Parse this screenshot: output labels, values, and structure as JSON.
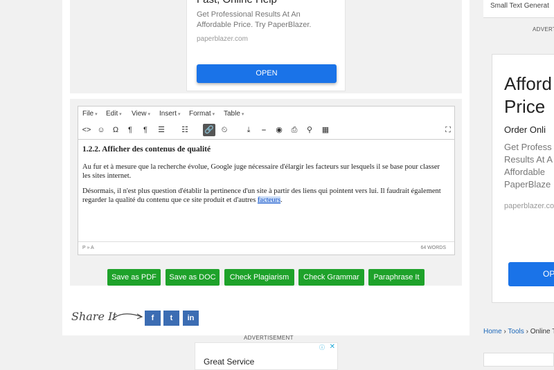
{
  "top_ad": {
    "headline": "Fast, Online Help",
    "description": "Get Professional Results At An Affordable Price. Try PaperBlazer.",
    "url": "paperblazer.com",
    "button": "OPEN"
  },
  "editor": {
    "menus": [
      "File",
      "Edit",
      "View",
      "Insert",
      "Format",
      "Table"
    ],
    "content": {
      "heading": "1.2.2. Afficher des contenus de qualité",
      "paragraph1": "Au fur et à mesure que la recherche évolue, Google juge nécessaire d'élargir les facteurs sur lesquels il se base pour classer les sites internet.",
      "paragraph2_before": "Désormais, il n'est plus question d'établir la pertinence d'un site à partir des liens qui pointent vers lui. Il faudrait également regarder la qualité du contenu que ce site produit et d'autres ",
      "paragraph2_link": "facteurs",
      "paragraph2_after": "."
    },
    "status_path": "P » A",
    "word_count": "64 WORDS"
  },
  "actions": {
    "save_pdf": "Save as PDF",
    "save_doc": "Save as DOC",
    "check_plagiarism": "Check Plagiarism",
    "check_grammar": "Check Grammar",
    "paraphrase": "Paraphrase It"
  },
  "share": {
    "label": "Share It",
    "facebook": "f",
    "twitter": "t",
    "linkedin": "in"
  },
  "bottom_ad": {
    "label": "ADVERTISEMENT",
    "headline": "Great Service"
  },
  "sidebar": {
    "tool_link": "Small Text Generat",
    "ad_label": "ADVERT",
    "ad": {
      "headline": "Afford\nPrice",
      "subheadline": "Order Onli",
      "description": "Get Profess\nResults At A\nAffordable\nPaperBlaze",
      "url": "paperblazer.com",
      "button": "OP"
    },
    "breadcrumb": {
      "home": "Home",
      "tools": "Tools",
      "current": "Online To"
    }
  },
  "colors": {
    "green_button": "#1ea22a",
    "blue_button": "#1a73e8",
    "social": "#3c6db3"
  }
}
